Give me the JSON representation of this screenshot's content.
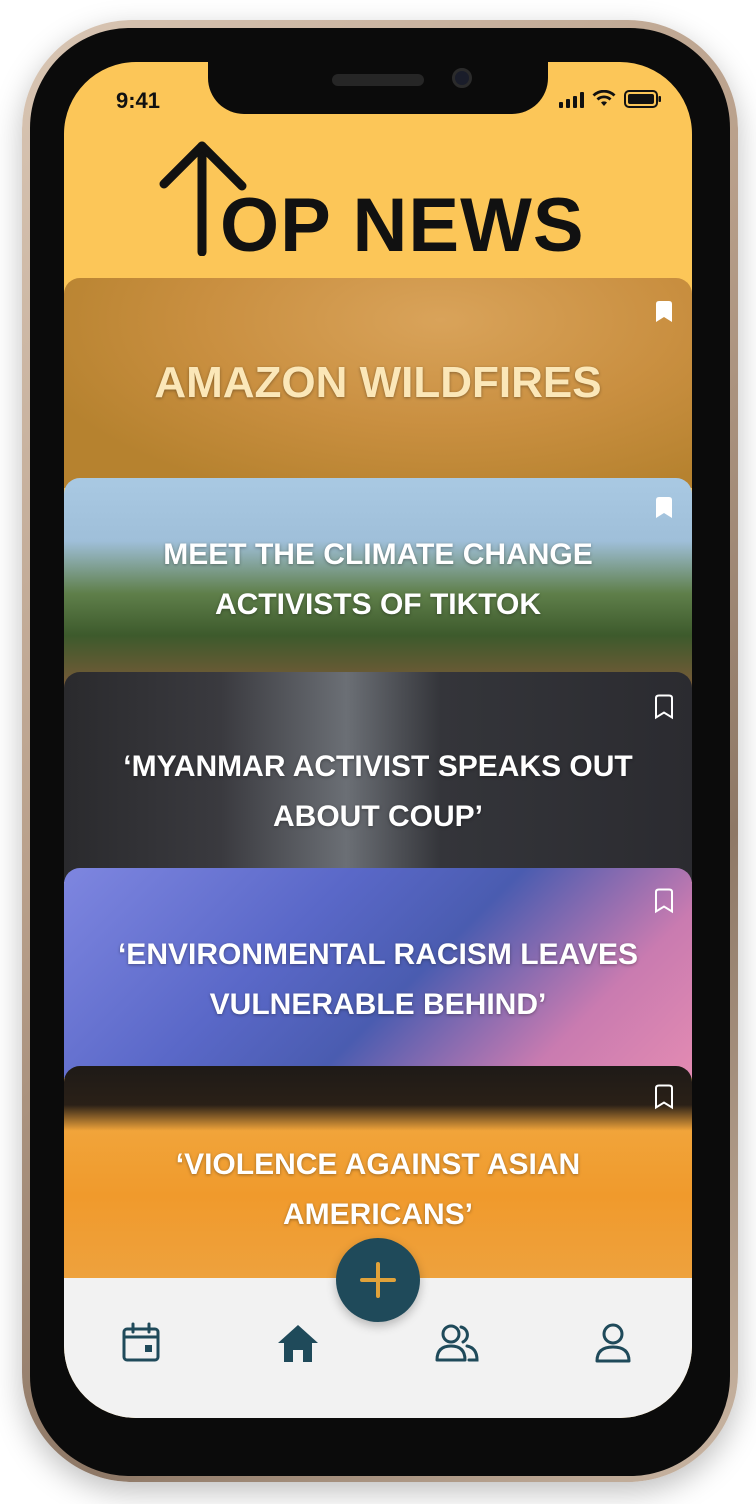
{
  "status_bar": {
    "time": "9:41"
  },
  "header": {
    "title": "OP NEWS"
  },
  "articles": [
    {
      "title": "AMAZON WILDFIRES",
      "bookmarked": true
    },
    {
      "title": "MEET THE CLIMATE CHANGE ACTIVISTS OF TIKTOK",
      "bookmarked": true
    },
    {
      "title": "‘MYANMAR ACTIVIST SPEAKS OUT ABOUT COUP’",
      "bookmarked": false
    },
    {
      "title": "‘ENVIRONMENTAL RACISM LEAVES VULNERABLE BEHIND’",
      "bookmarked": false
    },
    {
      "title": "‘VIOLENCE AGAINST ASIAN AMERICANS’",
      "bookmarked": false
    }
  ],
  "nav": {
    "items": [
      "calendar-icon",
      "home-icon",
      "group-icon",
      "profile-icon"
    ],
    "fab": "plus-icon",
    "active": "home-icon"
  },
  "colors": {
    "background": "#fcc658",
    "accent": "#1f4a5a",
    "fab_plus": "#e0a23a",
    "nav_bg": "#f2f2f2"
  }
}
